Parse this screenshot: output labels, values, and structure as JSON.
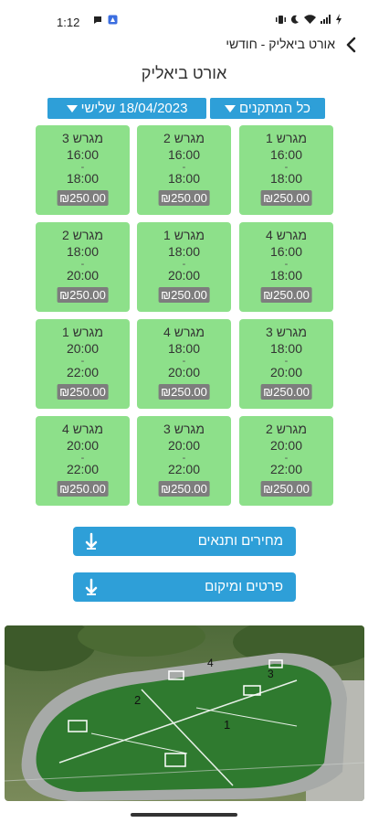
{
  "status": {
    "time": "1:12",
    "icons": [
      "chat-bubble-icon",
      "app-notification-icon",
      "vibrate-icon",
      "dnd-moon-icon",
      "wifi-icon",
      "signal-icon",
      "battery-charging-icon"
    ]
  },
  "header": {
    "title": "אורט ביאליק - חודשי",
    "back_icon": "chevron-left-icon"
  },
  "page_title": "אורט ביאליק",
  "filters": {
    "facilities": "כל המתקנים",
    "date": "18/04/2023 שלישי"
  },
  "slots": [
    {
      "court": "מגרש 1",
      "start": "16:00",
      "end": "18:00",
      "price": "₪250.00"
    },
    {
      "court": "מגרש 2",
      "start": "16:00",
      "end": "18:00",
      "price": "₪250.00"
    },
    {
      "court": "מגרש 3",
      "start": "16:00",
      "end": "18:00",
      "price": "₪250.00"
    },
    {
      "court": "מגרש 4",
      "start": "16:00",
      "end": "18:00",
      "price": "₪250.00"
    },
    {
      "court": "מגרש 1",
      "start": "18:00",
      "end": "20:00",
      "price": "₪250.00"
    },
    {
      "court": "מגרש 2",
      "start": "18:00",
      "end": "20:00",
      "price": "₪250.00"
    },
    {
      "court": "מגרש 3",
      "start": "18:00",
      "end": "20:00",
      "price": "₪250.00"
    },
    {
      "court": "מגרש 4",
      "start": "18:00",
      "end": "20:00",
      "price": "₪250.00"
    },
    {
      "court": "מגרש 1",
      "start": "20:00",
      "end": "22:00",
      "price": "₪250.00"
    },
    {
      "court": "מגרש 2",
      "start": "20:00",
      "end": "22:00",
      "price": "₪250.00"
    },
    {
      "court": "מגרש 3",
      "start": "20:00",
      "end": "22:00",
      "price": "₪250.00"
    },
    {
      "court": "מגרש 4",
      "start": "20:00",
      "end": "22:00",
      "price": "₪250.00"
    }
  ],
  "slot_separator": "-",
  "actions": {
    "prices": "מחירים ותנאים",
    "details": "פרטים ומיקום"
  },
  "photo": {
    "labels": [
      "1",
      "2",
      "3",
      "4"
    ]
  },
  "colors": {
    "accent": "#2e9fd8",
    "slot_bg": "#8de08a",
    "price_bg": "#7d7d7d"
  }
}
